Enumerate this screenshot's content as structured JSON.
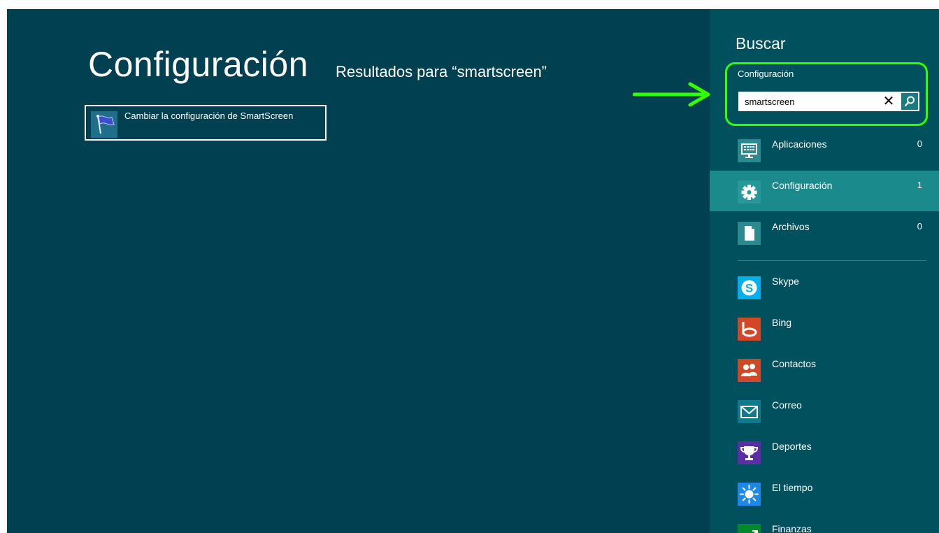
{
  "main": {
    "title": "Configuración",
    "subtitle": "Resultados para “smartscreen”",
    "results": [
      {
        "label": "Cambiar la configuración de SmartScreen",
        "icon": "flag-icon"
      }
    ]
  },
  "search_pane": {
    "title": "Buscar",
    "scope": "Configuración",
    "query": "smartscreen",
    "clear_glyph": "✕",
    "categories": [
      {
        "label": "Aplicaciones",
        "count": "0",
        "icon": "apps-keyboard-icon",
        "selected": false
      },
      {
        "label": "Configuración",
        "count": "1",
        "icon": "gear-icon",
        "selected": true
      },
      {
        "label": "Archivos",
        "count": "0",
        "icon": "file-icon",
        "selected": false
      }
    ],
    "apps": [
      {
        "label": "Skype",
        "icon": "skype-icon",
        "color": "#00aff0"
      },
      {
        "label": "Bing",
        "icon": "bing-icon",
        "color": "#d24726"
      },
      {
        "label": "Contactos",
        "icon": "people-icon",
        "color": "#d24726"
      },
      {
        "label": "Correo",
        "icon": "mail-icon",
        "color": "#0f7a8c"
      },
      {
        "label": "Deportes",
        "icon": "trophy-icon",
        "color": "#5b2ea6"
      },
      {
        "label": "El tiempo",
        "icon": "sun-icon",
        "color": "#1e88e5"
      },
      {
        "label": "Finanzas",
        "icon": "chart-up-icon",
        "color": "#00892b"
      }
    ]
  },
  "annotation": {
    "highlight_color": "#33ff00"
  }
}
